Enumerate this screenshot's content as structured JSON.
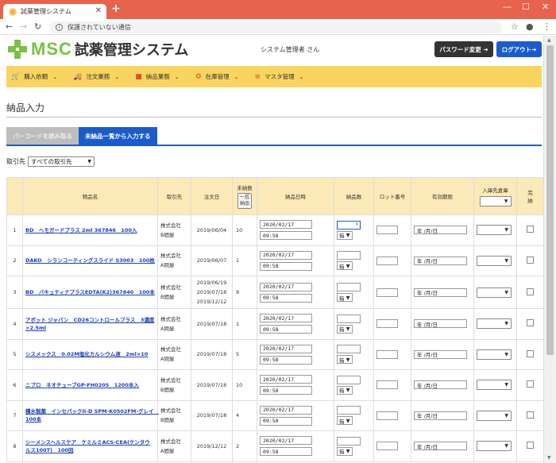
{
  "browser": {
    "tab_title": "試薬管理システム",
    "url_text": "保護されていない通信"
  },
  "header": {
    "logo_text": "MSC",
    "system_title": "試薬管理システム",
    "user_label": "システム管理者 さん",
    "password_button": "パスワード変更 ➔",
    "logout_button": "ログアウト➔"
  },
  "menu": [
    {
      "label": "購入依頼",
      "icon": "cart-icon"
    },
    {
      "label": "注文業務",
      "icon": "truck-icon"
    },
    {
      "label": "納品業務",
      "icon": "folder-icon"
    },
    {
      "label": "在庫管理",
      "icon": "gear-icon"
    },
    {
      "label": "マスタ管理",
      "icon": "database-icon"
    }
  ],
  "page_title": "納品入力",
  "tabs": [
    {
      "label": "バーコードを読み取る",
      "active": false
    },
    {
      "label": "未納品一覧から入力する",
      "active": true
    }
  ],
  "filter": {
    "label": "取引先",
    "selected": "すべての取引先"
  },
  "table": {
    "headers": {
      "num": "",
      "product": "物品名",
      "supplier": "取引先",
      "order_date": "注文日",
      "undelivered": "未納数",
      "bulk_button": "一括\n納品",
      "delivery_datetime": "納品日時",
      "delivery_qty": "納品数",
      "lot": "ロット番号",
      "expiry": "有効期限",
      "warehouse": "入庫先倉庫",
      "done": "完\n納"
    },
    "rows": [
      {
        "num": "1",
        "product": "BD　ヘモガードプラス 2ml 367846　100入",
        "supplier": "株式会社\nB間屋",
        "dates": [
          "2019/06/04"
        ],
        "undelivered": "10",
        "date": "2020/02/17",
        "time": "09:58",
        "unit": "箱",
        "expiry": "年 /月/日"
      },
      {
        "num": "2",
        "product": "DAKO　シランコーティングスライド S3003　100枚",
        "supplier": "株式会社\nA問屋",
        "dates": [
          "2019/06/07"
        ],
        "undelivered": "1",
        "date": "2020/02/17",
        "time": "09:58",
        "unit": "箱",
        "expiry": "年 /月/日"
      },
      {
        "num": "3",
        "product": "BD　バキュティナプラスEDTA(K2)367840　100本",
        "supplier": "株式会社\nB間屋",
        "dates": [
          "2019/06/19",
          "2019/07/18",
          "2019/12/12"
        ],
        "undelivered": "9",
        "date": "2020/02/17",
        "time": "09:58",
        "unit": "箱",
        "expiry": "年 /月/日"
      },
      {
        "num": "4",
        "product": "アボット ジャパン　CD26コントロールプラス　3濃度×2.5ml",
        "supplier": "株式会社\nA問屋",
        "dates": [
          "2019/07/18"
        ],
        "undelivered": "1",
        "date": "2020/02/17",
        "time": "09:58",
        "unit": "箱",
        "expiry": "年 /月/日"
      },
      {
        "num": "5",
        "product": "シスメックス　0.02M塩化カルシウム液　2ml×10",
        "supplier": "株式会社\nA問屋",
        "dates": [
          "2019/07/18"
        ],
        "undelivered": "5",
        "date": "2020/02/17",
        "time": "09:58",
        "unit": "箱",
        "expiry": "年 /月/日"
      },
      {
        "num": "6",
        "product": "ニプロ　ネオチューブGP-FH0205　1200本入",
        "supplier": "株式会社\nB間屋",
        "dates": [
          "2019/07/18"
        ],
        "undelivered": "10",
        "date": "2020/02/17",
        "time": "09:58",
        "unit": "箱",
        "expiry": "年 /月/日"
      },
      {
        "num": "7",
        "product": "積水製薬　インセパックII-D SPM-K0502FM-グレイ　100本",
        "supplier": "株式会社\nB間屋",
        "dates": [
          "2019/07/18"
        ],
        "undelivered": "4",
        "date": "2020/02/17",
        "time": "09:58",
        "unit": "箱",
        "expiry": "年 /月/日"
      },
      {
        "num": "8",
        "product": "シーメンスヘルスケア　ケミルミACS-CEA(ケンタウルス100T)　100回",
        "supplier": "株式会社\nA間屋",
        "dates": [
          "2019/12/12"
        ],
        "undelivered": "2",
        "date": "2020/02/17",
        "time": "09:58",
        "unit": "箱",
        "expiry": "年 /月/日"
      }
    ]
  }
}
